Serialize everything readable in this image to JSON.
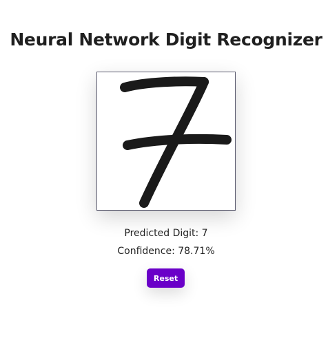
{
  "app": {
    "title": "Neural Network Digit Recognizer"
  },
  "canvas": {
    "drawn_digit_description_icon": "handwritten-seven",
    "stroke_color": "#1a1a1a",
    "border_color": "#5a5a6e"
  },
  "result": {
    "predicted_label": "Predicted Digit: 7",
    "confidence_label": "Confidence: 78.71%"
  },
  "controls": {
    "reset_label": "Reset",
    "reset_color": "#6a00c8"
  }
}
